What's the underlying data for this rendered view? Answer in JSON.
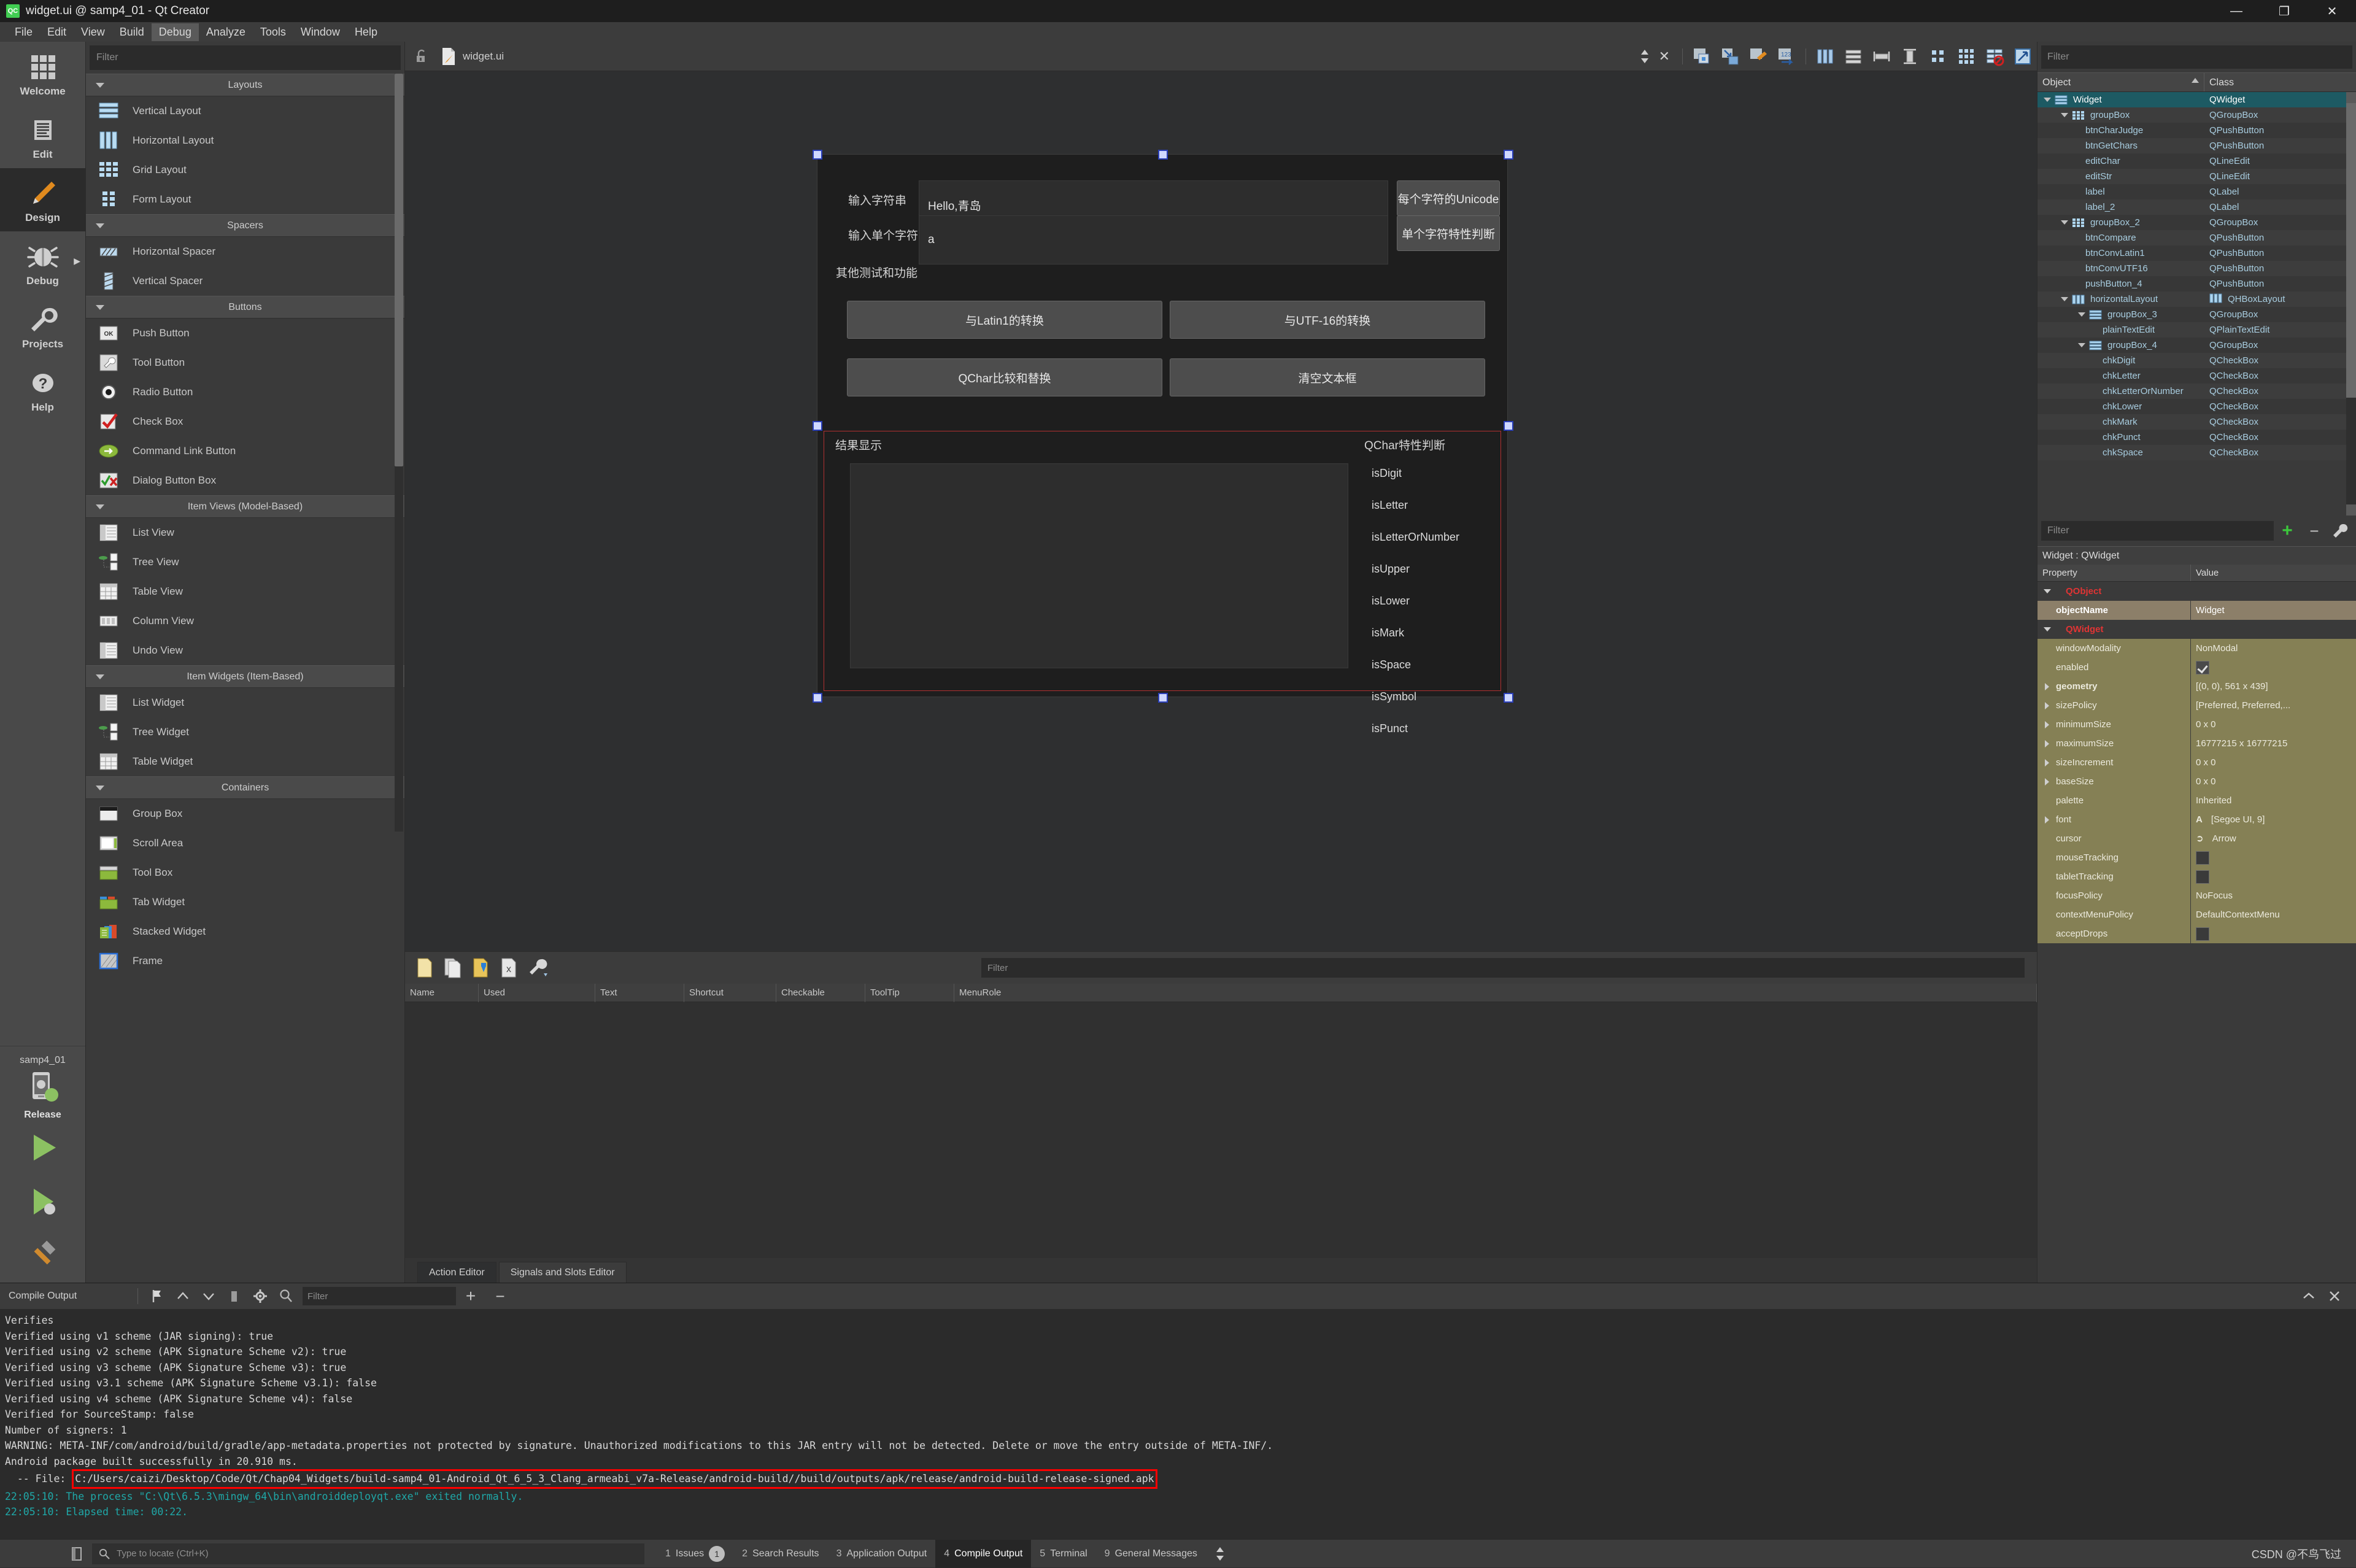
{
  "window": {
    "title": "widget.ui @ samp4_01 - Qt Creator",
    "logo": "qt-logo",
    "minimize": "—",
    "restore": "❐",
    "close": "✕"
  },
  "menubar": {
    "items": [
      {
        "label": "File"
      },
      {
        "label": "Edit"
      },
      {
        "label": "View"
      },
      {
        "label": "Build"
      },
      {
        "label": "Debug",
        "active": true
      },
      {
        "label": "Analyze"
      },
      {
        "label": "Tools"
      },
      {
        "label": "Window"
      },
      {
        "label": "Help"
      }
    ]
  },
  "modebar": {
    "items": [
      {
        "label": "Welcome",
        "icon": "grid-icon"
      },
      {
        "label": "Edit",
        "icon": "document-lines-icon"
      },
      {
        "label": "Design",
        "icon": "pencil-icon",
        "selected": true
      },
      {
        "label": "Debug",
        "icon": "bug-icon",
        "arrow": true
      },
      {
        "label": "Projects",
        "icon": "wrench-icon"
      },
      {
        "label": "Help",
        "icon": "question-mark-icon"
      }
    ],
    "kit": {
      "project": "samp4_01",
      "build_config": "Release",
      "device_icon": "android-device-icon",
      "run_icon": "run-play-icon",
      "debug_icon": "run-debug-icon",
      "build_icon": "hammer-icon"
    }
  },
  "widgetbox": {
    "filter_placeholder": "Filter",
    "categories": [
      {
        "name": "Layouts",
        "items": [
          {
            "label": "Vertical Layout",
            "icon": "vertical-layout-icon"
          },
          {
            "label": "Horizontal Layout",
            "icon": "horizontal-layout-icon"
          },
          {
            "label": "Grid Layout",
            "icon": "grid-layout-icon"
          },
          {
            "label": "Form Layout",
            "icon": "form-layout-icon"
          }
        ]
      },
      {
        "name": "Spacers",
        "items": [
          {
            "label": "Horizontal Spacer",
            "icon": "horizontal-spacer-icon"
          },
          {
            "label": "Vertical Spacer",
            "icon": "vertical-spacer-icon"
          }
        ]
      },
      {
        "name": "Buttons",
        "items": [
          {
            "label": "Push Button",
            "icon": "push-button-icon"
          },
          {
            "label": "Tool Button",
            "icon": "tool-button-icon"
          },
          {
            "label": "Radio Button",
            "icon": "radio-button-icon"
          },
          {
            "label": "Check Box",
            "icon": "check-box-icon"
          },
          {
            "label": "Command Link Button",
            "icon": "command-link-icon"
          },
          {
            "label": "Dialog Button Box",
            "icon": "dialog-button-box-icon"
          }
        ]
      },
      {
        "name": "Item Views (Model-Based)",
        "items": [
          {
            "label": "List View",
            "icon": "list-view-icon"
          },
          {
            "label": "Tree View",
            "icon": "tree-view-icon"
          },
          {
            "label": "Table View",
            "icon": "table-view-icon"
          },
          {
            "label": "Column View",
            "icon": "column-view-icon"
          },
          {
            "label": "Undo View",
            "icon": "undo-view-icon"
          }
        ]
      },
      {
        "name": "Item Widgets (Item-Based)",
        "items": [
          {
            "label": "List Widget",
            "icon": "list-widget-icon"
          },
          {
            "label": "Tree Widget",
            "icon": "tree-widget-icon"
          },
          {
            "label": "Table Widget",
            "icon": "table-widget-icon"
          }
        ]
      },
      {
        "name": "Containers",
        "items": [
          {
            "label": "Group Box",
            "icon": "group-box-icon"
          },
          {
            "label": "Scroll Area",
            "icon": "scroll-area-icon"
          },
          {
            "label": "Tool Box",
            "icon": "tool-box-icon"
          },
          {
            "label": "Tab Widget",
            "icon": "tab-widget-icon"
          },
          {
            "label": "Stacked Widget",
            "icon": "stacked-widget-icon"
          },
          {
            "label": "Frame",
            "icon": "frame-icon"
          }
        ]
      }
    ]
  },
  "editorbar": {
    "lock_icon": "unlocked-icon",
    "file_icon": "ui-file-icon",
    "filename": "widget.ui",
    "updown_icon": "updown-arrows-icon",
    "close_icon": "close-icon",
    "designer_tools": [
      "edit-widgets-icon",
      "edit-signals-slots-icon",
      "edit-buddies-icon",
      "edit-tab-order-icon",
      "lay-out-horizontally-icon",
      "lay-out-vertically-icon",
      "lay-out-in-splitter-h-icon",
      "lay-out-in-splitter-v-icon",
      "lay-out-in-form-icon",
      "lay-out-in-grid-icon",
      "break-layout-icon",
      "adjust-size-icon"
    ]
  },
  "form": {
    "labels": {
      "str_label": "输入字符串",
      "char_label": "输入单个字符",
      "section_label": "其他测试和功能",
      "result_group": "结果显示",
      "qchar_group": "QChar特性判断"
    },
    "inputs": {
      "str_value": "Hello,青岛",
      "char_value": "a"
    },
    "buttons": {
      "unicode": "每个字符的Unicode",
      "char_judge": "单个字符特性判断",
      "latin1": "与Latin1的转换",
      "utf16": "与UTF-16的转换",
      "compare": "QChar比较和替换",
      "clear": "清空文本框"
    },
    "checkboxes": [
      "isDigit",
      "isLetter",
      "isLetterOrNumber",
      "isUpper",
      "isLower",
      "isMark",
      "isSpace",
      "isSymbol",
      "isPunct"
    ]
  },
  "actiondock": {
    "toolbar_icons": [
      "new-action-icon",
      "copy-action-icon",
      "edit-action-icon",
      "delete-action-icon",
      "configure-icon"
    ],
    "filter_placeholder": "Filter",
    "add_icon": "+",
    "remove_icon": "−",
    "columns": [
      "Name",
      "Used",
      "Text",
      "Shortcut",
      "Checkable",
      "ToolTip",
      "MenuRole"
    ],
    "tabs": [
      {
        "label": "Action Editor",
        "selected": true
      },
      {
        "label": "Signals and Slots Editor",
        "selected": false
      }
    ]
  },
  "objecttree": {
    "filter_placeholder": "Filter",
    "columns": [
      "Object",
      "Class"
    ],
    "rows": [
      {
        "name": "Widget",
        "cls": "QWidget",
        "indent": 0,
        "expand": true,
        "icon": "widget-icon",
        "selected": true
      },
      {
        "name": "groupBox",
        "cls": "QGroupBox",
        "indent": 1,
        "expand": true,
        "icon": "groupbox-icon"
      },
      {
        "name": "btnCharJudge",
        "cls": "QPushButton",
        "indent": 2
      },
      {
        "name": "btnGetChars",
        "cls": "QPushButton",
        "indent": 2
      },
      {
        "name": "editChar",
        "cls": "QLineEdit",
        "indent": 2
      },
      {
        "name": "editStr",
        "cls": "QLineEdit",
        "indent": 2
      },
      {
        "name": "label",
        "cls": "QLabel",
        "indent": 2
      },
      {
        "name": "label_2",
        "cls": "QLabel",
        "indent": 2
      },
      {
        "name": "groupBox_2",
        "cls": "QGroupBox",
        "indent": 1,
        "expand": true,
        "icon": "groupbox-icon"
      },
      {
        "name": "btnCompare",
        "cls": "QPushButton",
        "indent": 2
      },
      {
        "name": "btnConvLatin1",
        "cls": "QPushButton",
        "indent": 2
      },
      {
        "name": "btnConvUTF16",
        "cls": "QPushButton",
        "indent": 2
      },
      {
        "name": "pushButton_4",
        "cls": "QPushButton",
        "indent": 2
      },
      {
        "name": "horizontalLayout",
        "cls": "QHBoxLayout",
        "indent": 1,
        "expand": true,
        "icon": "hbox-icon",
        "clsicon": "hbox-icon"
      },
      {
        "name": "groupBox_3",
        "cls": "QGroupBox",
        "indent": 2,
        "expand": true,
        "icon": "vbox-icon"
      },
      {
        "name": "plainTextEdit",
        "cls": "QPlainTextEdit",
        "indent": 3
      },
      {
        "name": "groupBox_4",
        "cls": "QGroupBox",
        "indent": 2,
        "expand": true,
        "icon": "vbox-icon"
      },
      {
        "name": "chkDigit",
        "cls": "QCheckBox",
        "indent": 3
      },
      {
        "name": "chkLetter",
        "cls": "QCheckBox",
        "indent": 3
      },
      {
        "name": "chkLetterOrNumber",
        "cls": "QCheckBox",
        "indent": 3
      },
      {
        "name": "chkLower",
        "cls": "QCheckBox",
        "indent": 3
      },
      {
        "name": "chkMark",
        "cls": "QCheckBox",
        "indent": 3
      },
      {
        "name": "chkPunct",
        "cls": "QCheckBox",
        "indent": 3
      },
      {
        "name": "chkSpace",
        "cls": "QCheckBox",
        "indent": 3
      }
    ]
  },
  "propertyeditor": {
    "filter_placeholder": "Filter",
    "add_icon": "+",
    "remove_icon": "−",
    "config_icon": "wrench-icon",
    "object_header": "Widget : QWidget",
    "columns": [
      "Property",
      "Value"
    ],
    "rows": [
      {
        "prop": "QObject",
        "val": "",
        "kind": "group",
        "tri": "open"
      },
      {
        "prop": "objectName",
        "val": "Widget",
        "kind": "tan"
      },
      {
        "prop": "QWidget",
        "val": "",
        "kind": "group",
        "tri": "open"
      },
      {
        "prop": "windowModality",
        "val": "NonModal",
        "kind": "olive"
      },
      {
        "prop": "enabled",
        "val": "",
        "kind": "olive",
        "check": true
      },
      {
        "prop": "geometry",
        "val": "[(0, 0), 561 x 439]",
        "kind": "olive",
        "tri": "closed",
        "bold": true
      },
      {
        "prop": "sizePolicy",
        "val": "[Preferred, Preferred,...",
        "kind": "olive",
        "tri": "closed"
      },
      {
        "prop": "minimumSize",
        "val": "0 x 0",
        "kind": "olive",
        "tri": "closed"
      },
      {
        "prop": "maximumSize",
        "val": "16777215 x 16777215",
        "kind": "olive",
        "tri": "closed"
      },
      {
        "prop": "sizeIncrement",
        "val": "0 x 0",
        "kind": "olive",
        "tri": "closed"
      },
      {
        "prop": "baseSize",
        "val": "0 x 0",
        "kind": "olive",
        "tri": "closed"
      },
      {
        "prop": "palette",
        "val": "Inherited",
        "kind": "olive"
      },
      {
        "prop": "font",
        "val": "[Segoe UI, 9]",
        "kind": "olive",
        "tri": "closed",
        "icon": "font-A-icon"
      },
      {
        "prop": "cursor",
        "val": "Arrow",
        "kind": "olive",
        "icon": "cursor-arrow-icon"
      },
      {
        "prop": "mouseTracking",
        "val": "",
        "kind": "olive",
        "uncheck": true
      },
      {
        "prop": "tabletTracking",
        "val": "",
        "kind": "olive",
        "uncheck": true
      },
      {
        "prop": "focusPolicy",
        "val": "NoFocus",
        "kind": "olive"
      },
      {
        "prop": "contextMenuPolicy",
        "val": "DefaultContextMenu",
        "kind": "olive"
      },
      {
        "prop": "acceptDrops",
        "val": "",
        "kind": "olive",
        "uncheck": true
      }
    ]
  },
  "output": {
    "title": "Compile Output",
    "filter_placeholder": "Filter",
    "icons": [
      "flag-icon",
      "arrow-up-icon",
      "arrow-down-icon",
      "stop-icon",
      "gear-icon",
      "search-icon"
    ],
    "zoom_in": "+",
    "zoom_out": "−",
    "maximize_icon": "chevron-up-icon",
    "close_icon": "close-icon",
    "lines": [
      {
        "text": "Verifies",
        "color": "normal"
      },
      {
        "text": "Verified using v1 scheme (JAR signing): true",
        "color": "normal"
      },
      {
        "text": "Verified using v2 scheme (APK Signature Scheme v2): true",
        "color": "normal"
      },
      {
        "text": "Verified using v3 scheme (APK Signature Scheme v3): true",
        "color": "normal"
      },
      {
        "text": "Verified using v3.1 scheme (APK Signature Scheme v3.1): false",
        "color": "normal"
      },
      {
        "text": "Verified using v4 scheme (APK Signature Scheme v4): false",
        "color": "normal"
      },
      {
        "text": "Verified for SourceStamp: false",
        "color": "normal"
      },
      {
        "text": "Number of signers: 1",
        "color": "normal"
      },
      {
        "text": "WARNING: META-INF/com/android/build/gradle/app-metadata.properties not protected by signature. Unauthorized modifications to this JAR entry will not be detected. Delete or move the entry outside of META-INF/.",
        "color": "normal"
      },
      {
        "text": "Android package built successfully in 20.910 ms.",
        "color": "normal"
      },
      {
        "prefix": "  -- File: ",
        "boxed": "C:/Users/caizi/Desktop/Code/Qt/Chap04_Widgets/build-samp4_01-Android_Qt_6_5_3_Clang_armeabi_v7a-Release/android-build//build/outputs/apk/release/android-build-release-signed.apk",
        "color": "normal"
      },
      {
        "text": "22:05:10: The process \"C:\\Qt\\6.5.3\\mingw_64\\bin\\androiddeployqt.exe\" exited normally.",
        "color": "teal"
      },
      {
        "text": "22:05:10: Elapsed time: 00:22.",
        "color": "teal"
      }
    ]
  },
  "statusbar": {
    "locate_placeholder": "Type to locate (Ctrl+K)",
    "sidebar_toggle_icon": "sidebar-toggle-icon",
    "search_icon": "search-icon",
    "tabs": [
      {
        "num": "1",
        "label": "Issues",
        "badge": "1"
      },
      {
        "num": "2",
        "label": "Search Results"
      },
      {
        "num": "3",
        "label": "Application Output"
      },
      {
        "num": "4",
        "label": "Compile Output",
        "selected": true
      },
      {
        "num": "5",
        "label": "Terminal"
      },
      {
        "num": "9",
        "label": "General Messages"
      }
    ],
    "updown_icon": "updown-arrows-icon",
    "watermark": "CSDN @不鸟飞过"
  },
  "colors": {
    "accent_teal": "#1d5a63",
    "qt_green": "#41cd52",
    "warn_red": "#ff0000",
    "olive": "#858055"
  }
}
